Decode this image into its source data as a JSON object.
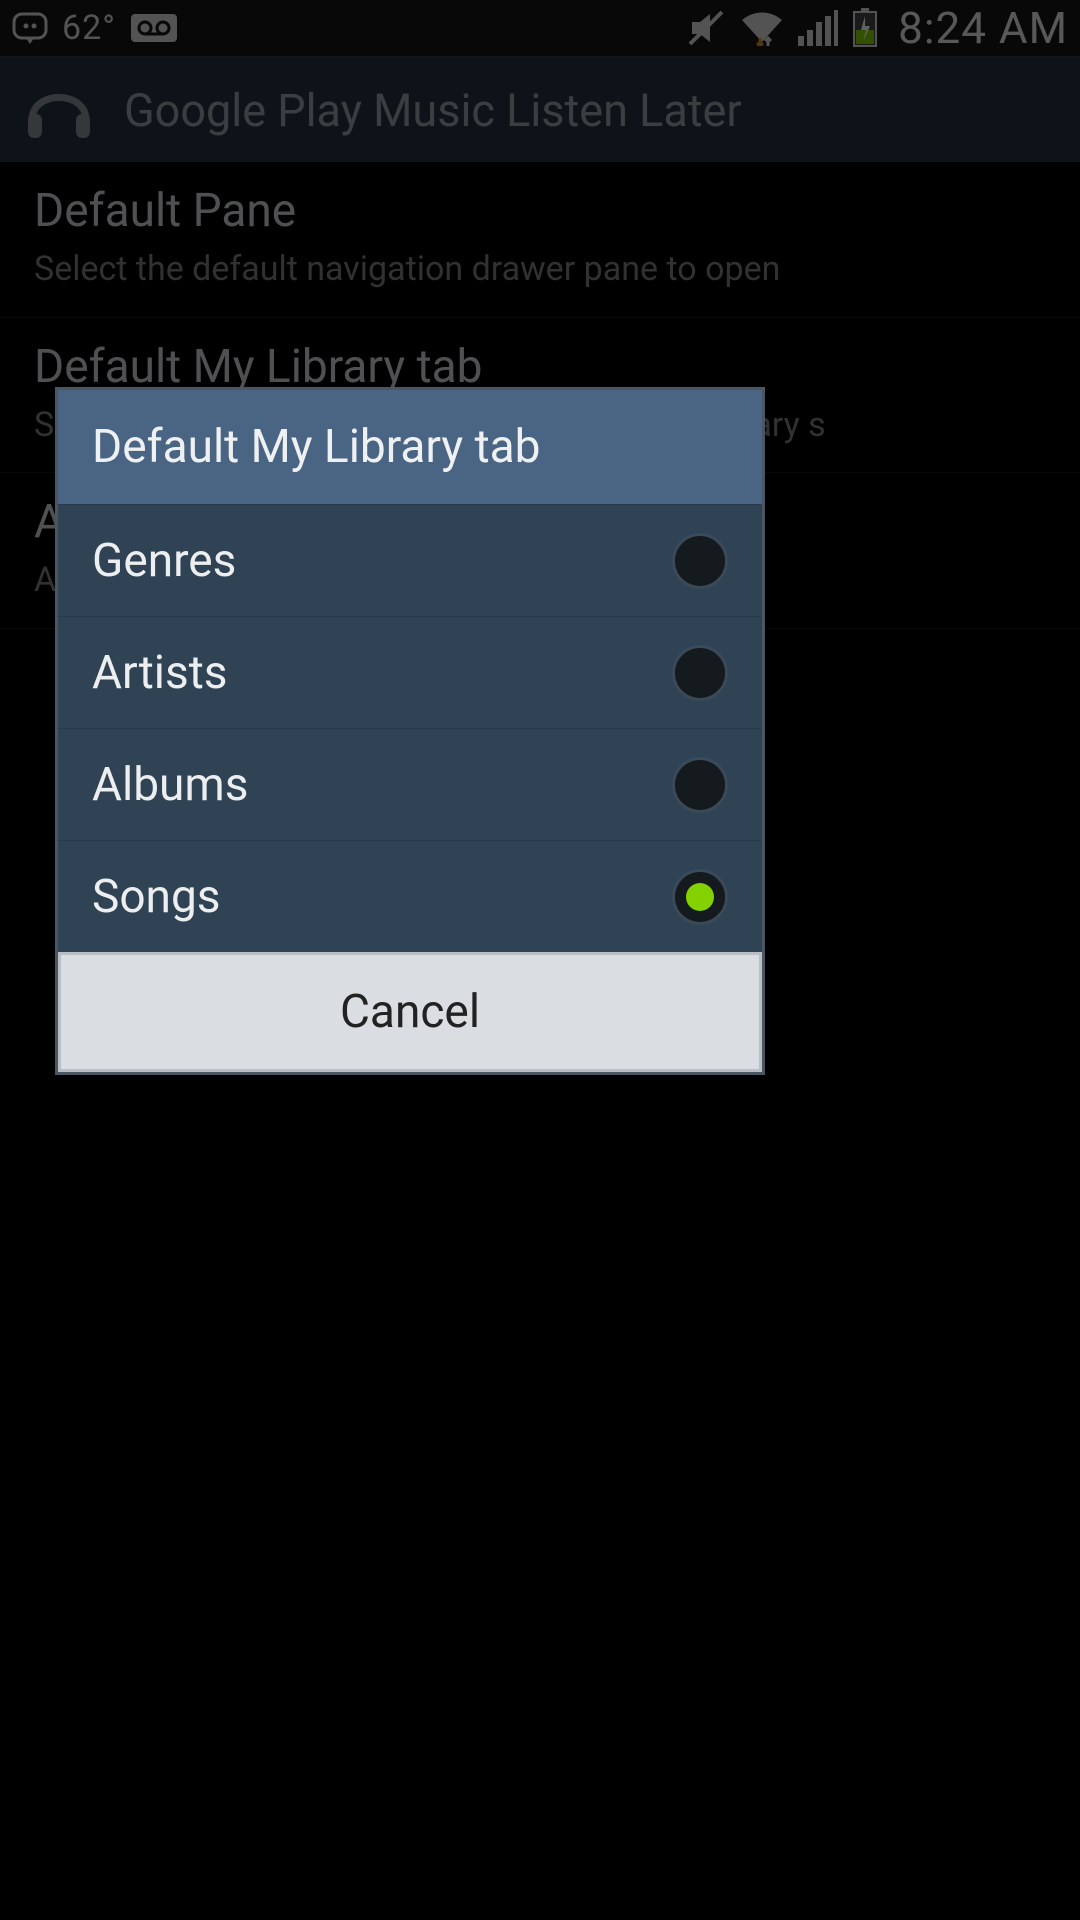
{
  "status": {
    "temperature": "62°",
    "time": "8:24 AM"
  },
  "appbar": {
    "title": "Google Play Music Listen Later"
  },
  "settings": [
    {
      "title": "Default Pane",
      "desc": "Select the default navigation drawer pane to open"
    },
    {
      "title": "Default My Library tab",
      "desc": "Select the tab to show by default for the My Library s"
    },
    {
      "title": "A",
      "desc": "A"
    }
  ],
  "dialog": {
    "title": "Default My Library tab",
    "options": [
      {
        "label": "Genres",
        "selected": false
      },
      {
        "label": "Artists",
        "selected": false
      },
      {
        "label": "Albums",
        "selected": false
      },
      {
        "label": "Songs",
        "selected": true
      }
    ],
    "cancel": "Cancel"
  }
}
